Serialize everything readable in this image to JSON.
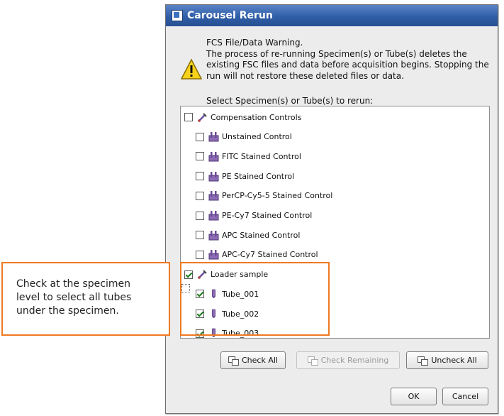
{
  "dialog": {
    "title": "Carousel Rerun",
    "warning_text": "FCS File/Data Warning.\nThe process of re-running Specimen(s) or Tube(s) deletes the existing FSC files and data before acquisition begins. Stopping the run will not restore these deleted files or data.",
    "select_label": "Select Specimen(s) or Tube(s) to rerun:",
    "tree": [
      {
        "label": "Compensation Controls",
        "level": 0,
        "checked": false,
        "icon": "specimen-icon"
      },
      {
        "label": "Unstained Control",
        "level": 1,
        "checked": false,
        "icon": "tube-rack-icon"
      },
      {
        "label": "FITC Stained Control",
        "level": 1,
        "checked": false,
        "icon": "tube-rack-icon"
      },
      {
        "label": "PE Stained Control",
        "level": 1,
        "checked": false,
        "icon": "tube-rack-icon"
      },
      {
        "label": "PerCP-Cy5-5 Stained Control",
        "level": 1,
        "checked": false,
        "icon": "tube-rack-icon"
      },
      {
        "label": "PE-Cy7 Stained Control",
        "level": 1,
        "checked": false,
        "icon": "tube-rack-icon"
      },
      {
        "label": "APC Stained Control",
        "level": 1,
        "checked": false,
        "icon": "tube-rack-icon"
      },
      {
        "label": "APC-Cy7 Stained Control",
        "level": 1,
        "checked": false,
        "icon": "tube-rack-icon"
      },
      {
        "label": "Loader sample",
        "level": 0,
        "checked": true,
        "icon": "specimen-icon"
      },
      {
        "label": "Tube_001",
        "level": 1,
        "checked": true,
        "icon": "tube-icon"
      },
      {
        "label": "Tube_002",
        "level": 1,
        "checked": true,
        "icon": "tube-icon"
      },
      {
        "label": "Tube_003",
        "level": 1,
        "checked": true,
        "icon": "tube-icon"
      }
    ],
    "buttons": {
      "check_all": "Check All",
      "check_remaining": "Check Remaining",
      "uncheck_all": "Uncheck All",
      "ok": "OK",
      "cancel": "Cancel"
    }
  },
  "callout": {
    "text": "Check at the specimen\nlevel to select all tubes\nunder the specimen."
  },
  "colors": {
    "accent": "#ee7a22",
    "titlebar": "#2f5ea8",
    "check": "#1c7a1c"
  }
}
